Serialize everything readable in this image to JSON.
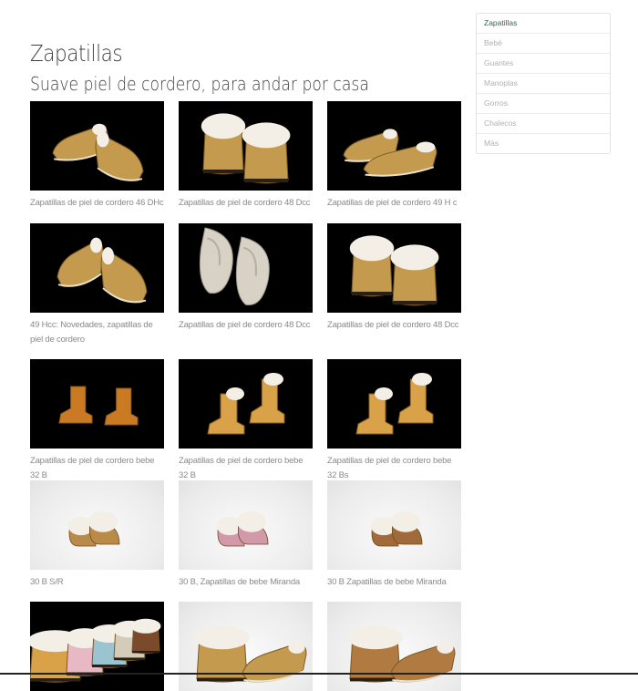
{
  "header": {
    "title": "Zapatillas",
    "subtitle": "Suave piel de cordero, para andar por casa"
  },
  "sidebar": {
    "items": [
      {
        "label": "Zapatillas",
        "active": true
      },
      {
        "label": "Bebé",
        "active": false
      },
      {
        "label": "Guantes",
        "active": false
      },
      {
        "label": "Manoplas",
        "active": false
      },
      {
        "label": "Gorros",
        "active": false
      },
      {
        "label": "Chalecos",
        "active": false
      },
      {
        "label": "Más",
        "active": false
      }
    ]
  },
  "products": [
    {
      "caption": "Zapatillas de piel de cordero 46 DHc",
      "bg": "dark",
      "image": "mules-pair-sheepskin-lining"
    },
    {
      "caption": "Zapatillas de piel de cordero 48 Dcc",
      "bg": "dark",
      "image": "clogs-pair-fur-cuff"
    },
    {
      "caption": "Zapatillas de piel de cordero 49 H c",
      "bg": "dark",
      "image": "mules-pair-angled"
    },
    {
      "caption": "49 Hcc: Novedades, zapatillas de piel de cordero",
      "bg": "dark",
      "image": "mules-pair-side"
    },
    {
      "caption": "Zapatillas de piel de cordero 48 Dcc",
      "bg": "dark",
      "image": "white-fur-slippers-pair"
    },
    {
      "caption": "Zapatillas de piel de cordero 48 Dcc",
      "bg": "dark",
      "image": "clogs-pair-fur-cuff"
    },
    {
      "caption": "Zapatillas de piel de cordero bebe 32 B",
      "bg": "dark",
      "image": "baby-boots-orange"
    },
    {
      "caption": "Zapatillas de piel de cordero bebe 32 B",
      "bg": "dark",
      "image": "baby-boots-fur-trim"
    },
    {
      "caption": "Zapatillas de piel de cordero bebe 32 Bs",
      "bg": "dark",
      "image": "baby-boots-fur-trim"
    },
    {
      "caption": "30 B S/R",
      "bg": "light",
      "image": "baby-booties-tan"
    },
    {
      "caption": "30 B, Zapatillas de bebe Miranda",
      "bg": "light",
      "image": "baby-booties-pink"
    },
    {
      "caption": "30 B Zapatillas de bebe Miranda",
      "bg": "light",
      "image": "baby-booties-brown"
    },
    {
      "caption": "",
      "bg": "dark",
      "image": "multicolor-clogs-row"
    },
    {
      "caption": "",
      "bg": "light",
      "image": "clogs-pair-light"
    },
    {
      "caption": "",
      "bg": "light",
      "image": "clogs-pair-brown-light"
    }
  ],
  "colors": {
    "accent": "#2e6a4c",
    "title": "#3f3f3f",
    "caption": "#8a8a8a",
    "sheepskin": "#c49a4e",
    "fur": "#f3efe6"
  }
}
